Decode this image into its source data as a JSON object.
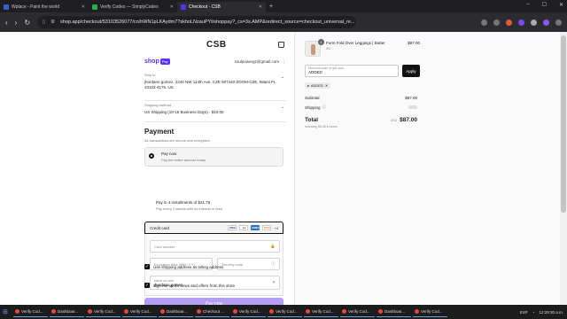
{
  "browser": {
    "tabs": [
      {
        "title": "Wplace - Paint the world",
        "active": false,
        "color": "#3b5fc4"
      },
      {
        "title": "Verify Codes — SimplyCodes",
        "active": false,
        "color": "#2fa84f"
      },
      {
        "title": "Checkout - CSB",
        "active": true,
        "color": "#5a31f4"
      }
    ],
    "url": "shop.app/checkout/53103526077/cn/hWN1pLKAydm7?skhnLNzauPYt/shoppay?_cs=3s.AMP&redirect_source=checkout_universal_re..."
  },
  "header": {
    "logo": "CSB"
  },
  "shop": {
    "logo": "shop",
    "badge": "Pay",
    "email": "soulpowergz@gmail.com"
  },
  "ship_to": {
    "label": "Ship to",
    "value": "jhordano gomez, 2240 NW 114th Ave, CZE 507440 ZOOM-CZE, Miami FL 33102-4176, US"
  },
  "shipping_method": {
    "label": "Shipping method",
    "value": "US Shipping (10-15 Business Days) · $10.00"
  },
  "payment": {
    "title": "Payment",
    "subtitle": "All transactions are secure and encrypted.",
    "pay_now": {
      "title": "Pay now",
      "desc": "Pay the entire amount today"
    },
    "installments": {
      "title": "Pay in 4 installments of $21.75",
      "desc": "Pay every 2 weeks with no interest or fees"
    },
    "credit_card": {
      "label": "Credit card",
      "brands": [
        "VISA",
        "MC",
        "AMEX",
        "DISC"
      ],
      "more": "+4",
      "card_number": "Card number",
      "expiration": "Expiration date (MM / YY)",
      "security": "Security code",
      "name_label": "Name on card",
      "name_value": "jhordano gomez"
    },
    "billing_checkbox": "Use shipping address as billing address",
    "signup_checkbox": "Sign me up for news and offers from this store",
    "pay_button": "Pay now"
  },
  "order": {
    "product": {
      "name": "Form Fold Over Leggings | Butter",
      "variant": "XS",
      "price": "$87.00",
      "qty": "1"
    },
    "discount": {
      "label": "Discount code or gift card",
      "value": "ADDED",
      "apply": "Apply",
      "tag": "ADDED"
    },
    "subtotal_label": "Subtotal",
    "subtotal": "$87.00",
    "shipping_label": "Shipping",
    "total_label": "Total",
    "currency": "USD",
    "total": "$87.00",
    "taxes": "Including $5.68 in taxes"
  },
  "taskbar": {
    "items": [
      "Verify Cod...",
      "Dashboar...",
      "Verify Cod...",
      "Verify Cod...",
      "Dashboar...",
      "Checkout ...",
      "Verify Cod...",
      "Verify Cod...",
      "Verify Cod...",
      "Verify Cod...",
      "Dashboar...",
      "Verify Cod..."
    ],
    "lang": "ESP",
    "time": "12:29:30 a.m."
  }
}
